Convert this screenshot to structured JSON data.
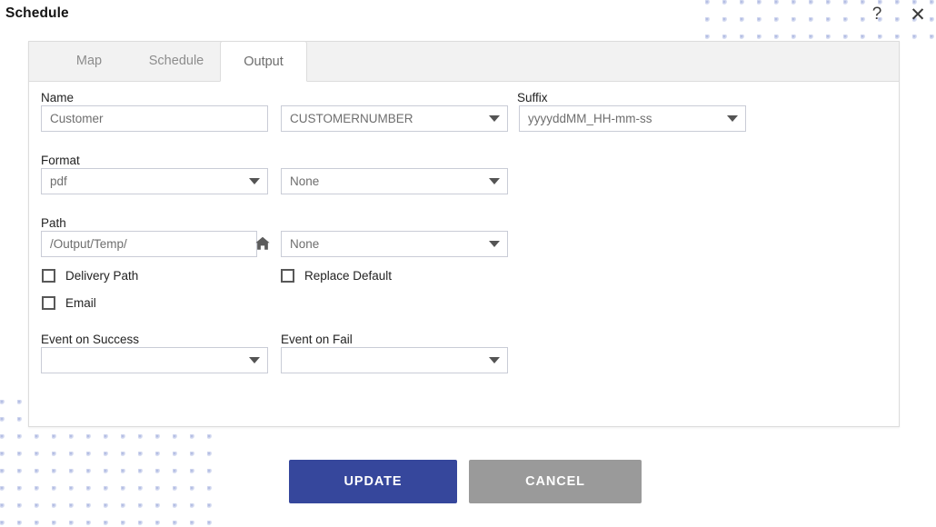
{
  "window": {
    "title": "Schedule",
    "help_icon": "question-mark-icon",
    "close_icon": "close-icon"
  },
  "tabs": [
    {
      "label": "Map",
      "active": false
    },
    {
      "label": "Schedule",
      "active": false
    },
    {
      "label": "Output",
      "active": true
    }
  ],
  "form": {
    "name_label": "Name",
    "name_value": "Customer",
    "name_token_value": "CUSTOMERNUMBER",
    "suffix_label": "Suffix",
    "suffix_value": "yyyyddMM_HH-mm-ss",
    "format_label": "Format",
    "format_value": "pdf",
    "format_secondary_value": "None",
    "path_label": "Path",
    "path_value": "/Output/Temp/",
    "path_secondary_value": "None",
    "home_icon": "home-icon",
    "delivery_path_label": "Delivery Path",
    "delivery_path_checked": false,
    "replace_default_label": "Replace Default",
    "replace_default_checked": false,
    "email_label": "Email",
    "email_checked": false,
    "event_on_success_label": "Event on Success",
    "event_on_success_value": "",
    "event_on_fail_label": "Event on Fail",
    "event_on_fail_value": ""
  },
  "footer": {
    "update_label": "UPDATE",
    "cancel_label": "CANCEL"
  },
  "colors": {
    "primary": "#36479c",
    "secondary": "#9a9a9a",
    "pattern_dot": "#a9b4e0",
    "border": "#c9ccd6"
  }
}
